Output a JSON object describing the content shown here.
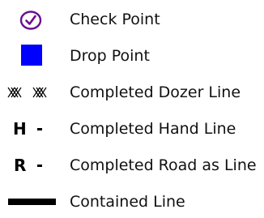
{
  "legend": {
    "items": [
      {
        "symbol": "check-circle-icon",
        "label": "Check Point",
        "color": "#6a0f8e"
      },
      {
        "symbol": "blue-square-icon",
        "label": "Drop Point",
        "color": "#0000ff"
      },
      {
        "symbol": "dozer-line-symbol",
        "label": "Completed Dozer Line",
        "color": "#000000"
      },
      {
        "symbol": "H -",
        "code_letter": "H",
        "label": "Completed Hand Line",
        "color": "#000000"
      },
      {
        "symbol": "R -",
        "code_letter": "R",
        "label": "Completed Road as Line",
        "color": "#000000"
      },
      {
        "symbol": "thick-black-bar",
        "label": "Contained Line",
        "color": "#000000"
      }
    ]
  }
}
